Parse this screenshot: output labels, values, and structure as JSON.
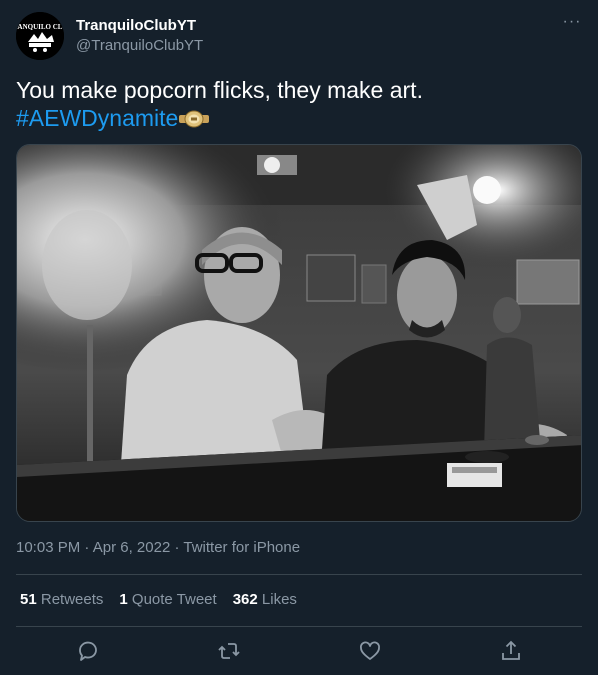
{
  "author": {
    "display_name": "TranquiloClubYT",
    "handle": "@TranquiloClubYT",
    "avatar_text": "TRANQUILO CLUB"
  },
  "more_label": "···",
  "tweet": {
    "text_line1": "You make popcorn flicks, they make art.",
    "hashtag": "#AEWDynamite"
  },
  "meta": {
    "time": "10:03 PM",
    "date": "Apr 6, 2022",
    "source": "Twitter for iPhone",
    "sep": " · "
  },
  "stats": {
    "retweets_count": "51",
    "retweets_label": "Retweets",
    "quotes_count": "1",
    "quotes_label": "Quote Tweet",
    "likes_count": "362",
    "likes_label": "Likes"
  },
  "actions": {
    "reply_icon": "reply-icon",
    "retweet_icon": "retweet-icon",
    "like_icon": "heart-icon",
    "share_icon": "share-icon"
  },
  "colors": {
    "background": "#15202b",
    "accent": "#1d9bf0",
    "muted": "#8b98a5",
    "border": "#38444d"
  }
}
